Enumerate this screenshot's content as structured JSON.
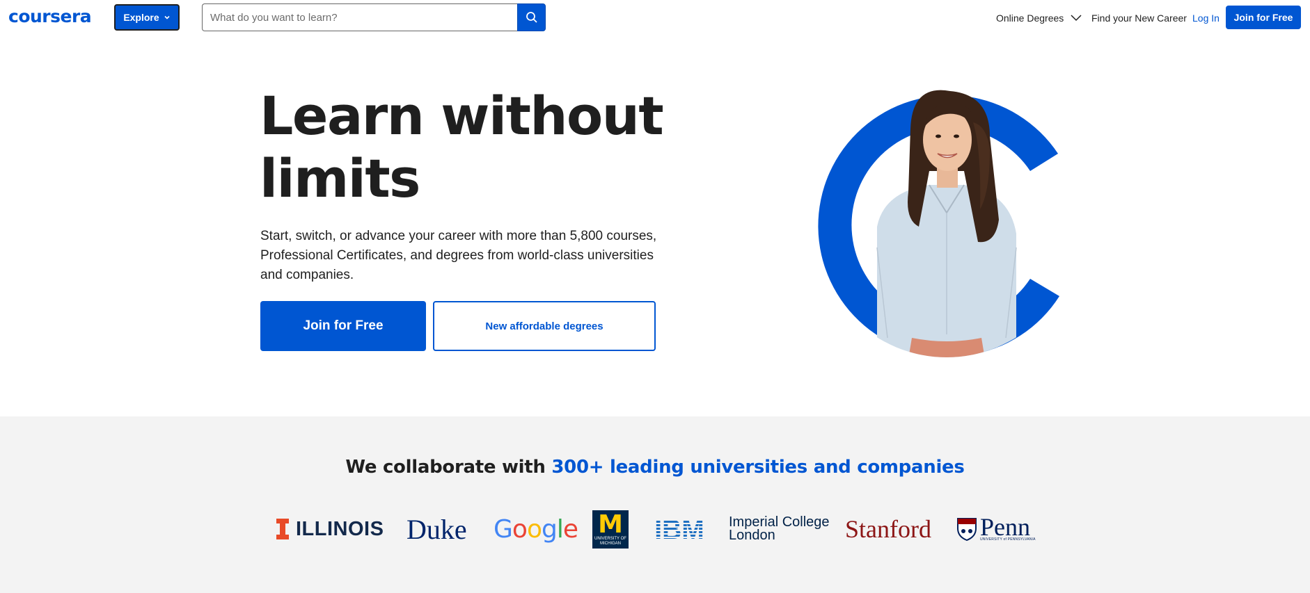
{
  "header": {
    "logo_text": "coursera",
    "explore_label": "Explore",
    "search": {
      "placeholder": "What do you want to learn?",
      "value": ""
    },
    "nav": {
      "online_degrees": "Online Degrees",
      "find_career": "Find your New Career",
      "login": "Log In",
      "join": "Join for Free"
    }
  },
  "hero": {
    "title": "Learn without limits",
    "subtitle": "Start, switch, or advance your career with more than 5,800 courses, Professional Certificates, and degrees from world-class universities and companies.",
    "primary_cta": "Join for Free",
    "secondary_cta": "New affordable degrees"
  },
  "collab": {
    "title_plain": "We collaborate with ",
    "title_accent": "300+ leading universities and companies",
    "partners": {
      "illinois": "ILLINOIS",
      "duke": "Duke",
      "google": [
        "G",
        "o",
        "o",
        "g",
        "l",
        "e"
      ],
      "michigan": {
        "mark": "M",
        "line1": "UNIVERSITY OF",
        "line2": "MICHIGAN"
      },
      "ibm": "IBM",
      "imperial_line1": "Imperial College",
      "imperial_line2": "London",
      "stanford": "Stanford",
      "penn": "Penn",
      "penn_sub": "UNIVERSITY of PENNSYLVANIA"
    }
  },
  "colors": {
    "brand_blue": "#0056d2",
    "text": "#1f1f1f",
    "band_bg": "#f3f3f3"
  },
  "icons": {
    "explore_chevron": "chevron-down-icon",
    "search": "search-icon",
    "degrees_chevron": "chevron-down-icon"
  }
}
